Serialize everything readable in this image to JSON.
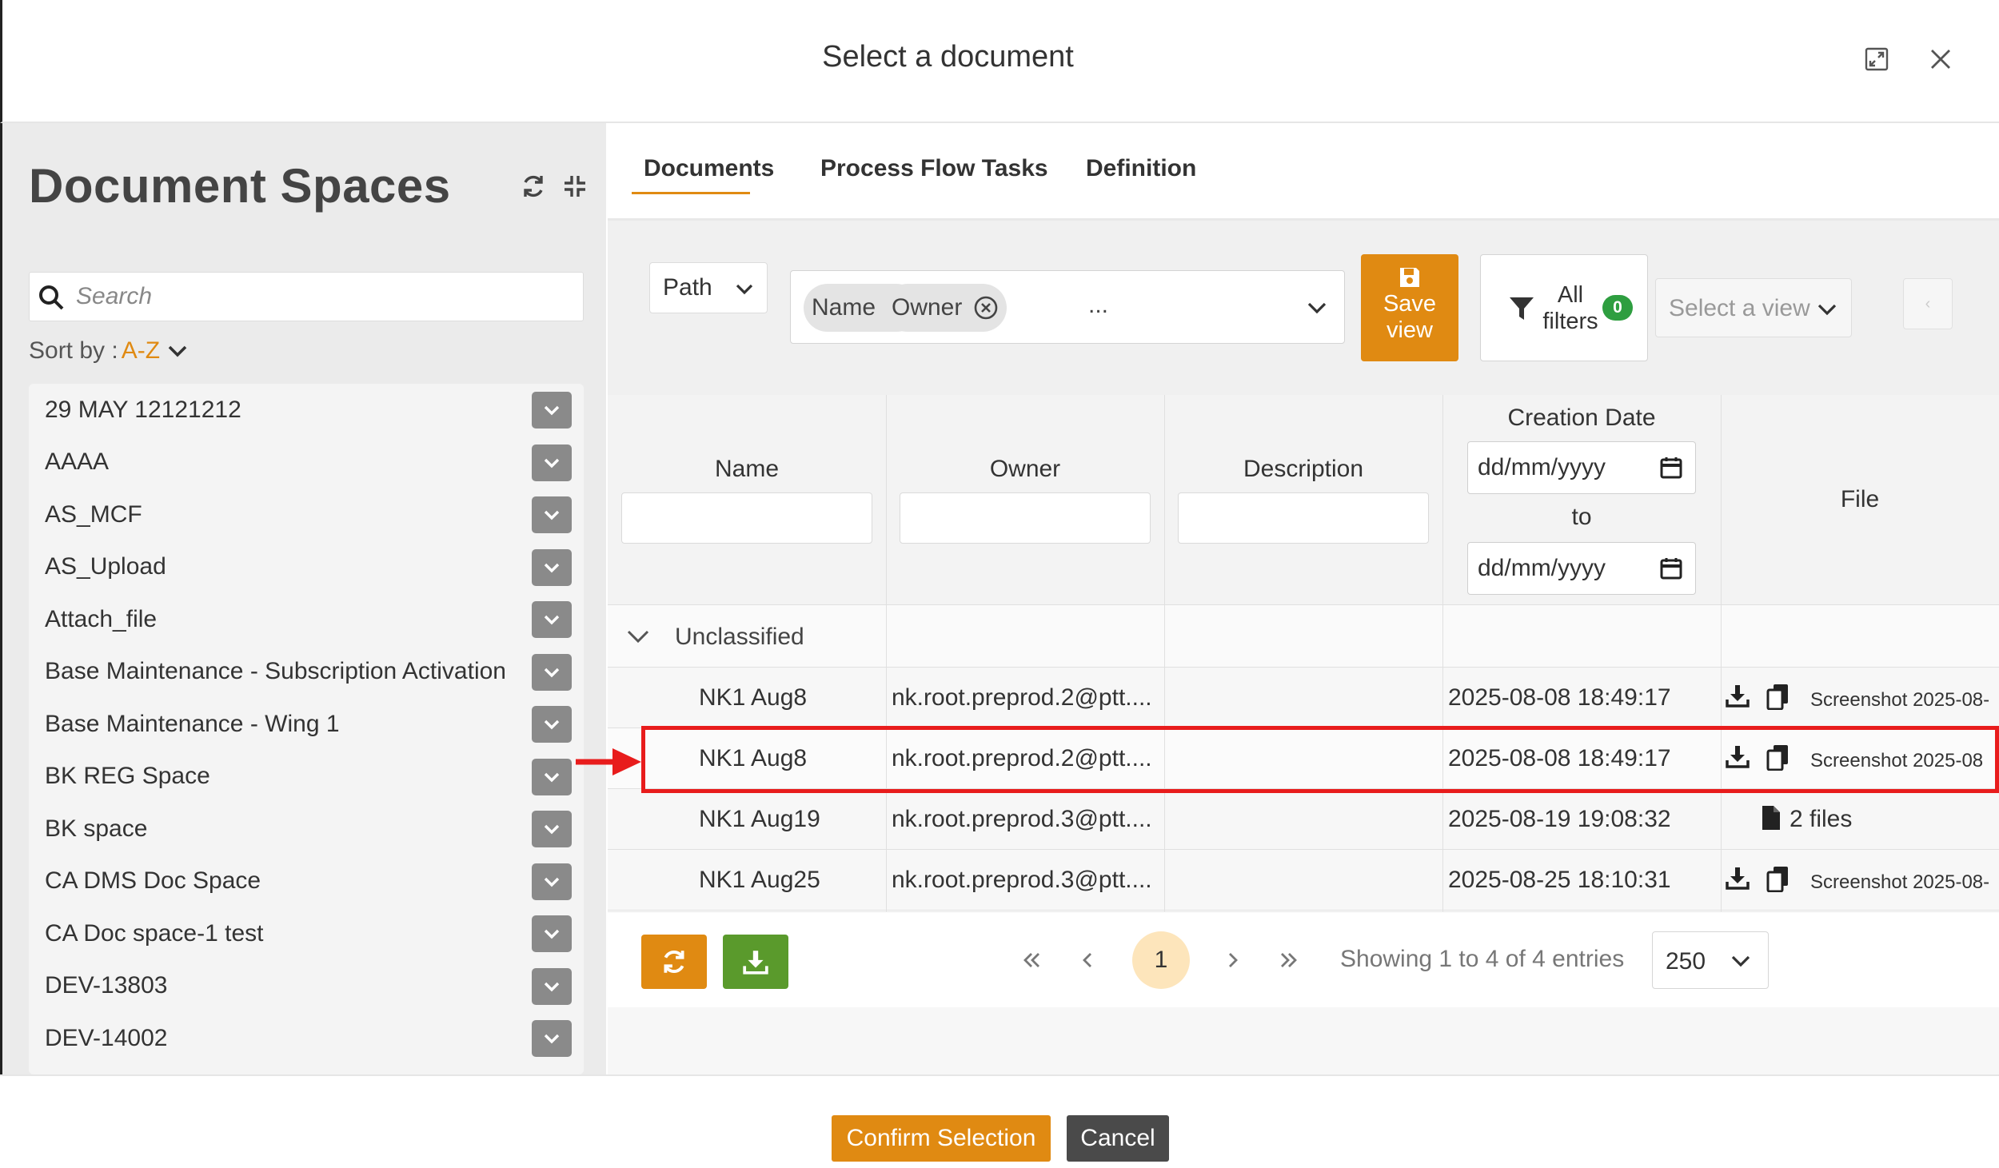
{
  "modal": {
    "title": "Select a document"
  },
  "left_panel": {
    "title": "Document Spaces",
    "search_placeholder": "Search",
    "sort_label": "Sort by :",
    "sort_value": "A-Z",
    "spaces": [
      "29 MAY 12121212",
      "AAAA",
      "AS_MCF",
      "AS_Upload",
      "Attach_file",
      "Base Maintenance - Subscription Activation",
      "Base Maintenance - Wing 1",
      "BK REG Space",
      "BK space",
      "CA DMS Doc Space",
      "CA Doc space-1 test",
      "DEV-13803",
      "DEV-14002"
    ]
  },
  "tabs": [
    {
      "label": "Documents",
      "active": true
    },
    {
      "label": "Process Flow Tasks",
      "active": false
    },
    {
      "label": "Definition",
      "active": false
    }
  ],
  "toolbar": {
    "path_label": "Path",
    "column_chips": [
      "Name",
      "Owner"
    ],
    "column_more": "...",
    "save_view_line1": "Save",
    "save_view_line2": "view",
    "filters_line1": "All",
    "filters_line2": "filters",
    "filters_count": "0",
    "view_placeholder": "Select a view",
    "tiny_button": "‹"
  },
  "grid": {
    "columns": [
      "Name",
      "Owner",
      "Description",
      "Creation Date",
      "File"
    ],
    "date_placeholder_from": "dd/mm/yyyy",
    "date_to_label": "to",
    "date_placeholder_to": "dd/mm/yyyy",
    "group_label": "Unclassified",
    "rows": [
      {
        "name": "NK1 Aug8",
        "owner": "nk.root.preprod.2@ptt....",
        "date": "2025-08-08 18:49:17",
        "file": "Screenshot 2025-08-",
        "files_count": ""
      },
      {
        "name": "NK1 Aug8",
        "owner": "nk.root.preprod.2@ptt....",
        "date": "2025-08-08 18:49:17",
        "file": "Screenshot 2025-08",
        "files_count": ""
      },
      {
        "name": "NK1 Aug19",
        "owner": "nk.root.preprod.3@ptt....",
        "date": "2025-08-19 19:08:32",
        "file": "",
        "files_count": "2 files"
      },
      {
        "name": "NK1 Aug25",
        "owner": "nk.root.preprod.3@ptt....",
        "date": "2025-08-25 18:10:31",
        "file": "Screenshot 2025-08-",
        "files_count": ""
      }
    ]
  },
  "pager": {
    "current_page": "1",
    "info": "Showing 1 to 4 of 4 entries",
    "page_size": "250"
  },
  "footer": {
    "confirm_label": "Confirm Selection",
    "cancel_label": "Cancel"
  },
  "colors": {
    "accent": "#e08a12",
    "badge_green": "#2e9e40",
    "export_green": "#5a9a2c",
    "highlight_red": "#e81c1c"
  }
}
